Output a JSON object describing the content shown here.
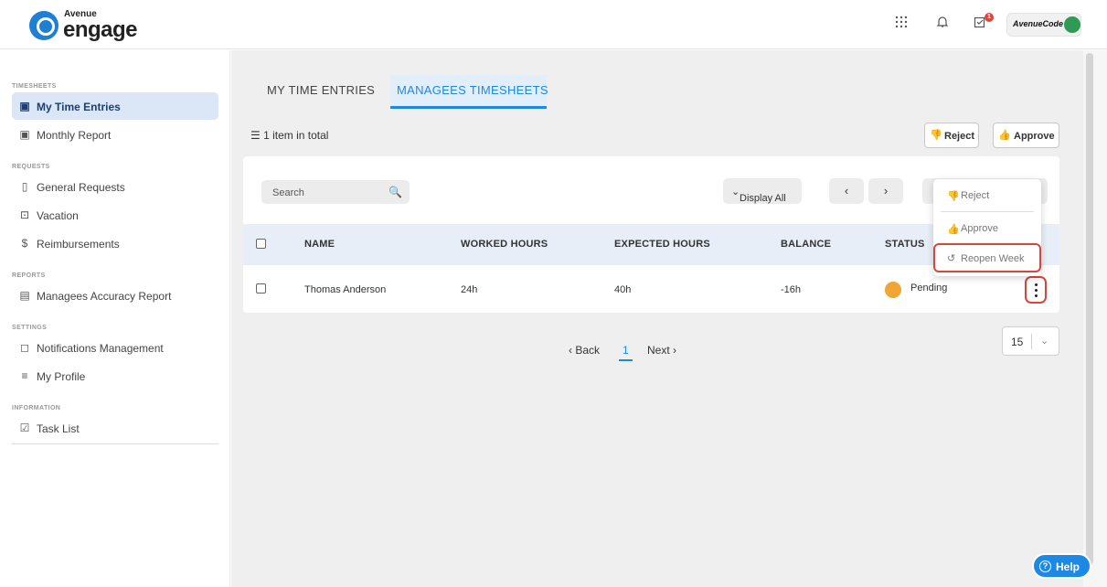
{
  "header": {
    "logo_top": "Avenue",
    "logo_main": "engage",
    "notification_badge": "1",
    "account_logo": "AvenueCode",
    "icons": [
      "apps-grid-icon",
      "bell-icon",
      "tasks-icon",
      "user-avatar-icon"
    ]
  },
  "sidebar": {
    "sections": [
      {
        "title": "TIMESHEETS",
        "items": [
          {
            "label": "My Time Entries",
            "icon": "calendar-icon",
            "active": true
          },
          {
            "label": "Monthly Report",
            "icon": "calendar-icon"
          }
        ]
      },
      {
        "title": "REQUESTS",
        "items": [
          {
            "label": "General Requests",
            "icon": "clipboard-icon"
          },
          {
            "label": "Vacation",
            "icon": "briefcase-icon"
          },
          {
            "label": "Reimbursements",
            "icon": "dollar-icon"
          }
        ]
      },
      {
        "title": "REPORTS",
        "items": [
          {
            "label": "Managees Accuracy Report",
            "icon": "document-icon"
          }
        ]
      },
      {
        "title": "SETTINGS",
        "items": [
          {
            "label": "Notifications Management",
            "icon": "chat-bubble-icon"
          },
          {
            "label": "My Profile",
            "icon": "list-icon"
          }
        ]
      },
      {
        "title": "INFORMATION",
        "items": [
          {
            "label": "Task List",
            "icon": "checkbox-icon"
          }
        ]
      }
    ]
  },
  "main": {
    "tabs": [
      {
        "label": "MY TIME ENTRIES"
      },
      {
        "label": "MANAGEES TIMESHEETS",
        "active": true
      }
    ],
    "total_text": "1 item in total",
    "reject_label": "Reject",
    "approve_label": "Approve",
    "search_placeholder": "Search",
    "display_all": "Display All",
    "table": {
      "columns": [
        "NAME",
        "WORKED HOURS",
        "EXPECTED HOURS",
        "BALANCE",
        "STATUS"
      ],
      "rows": [
        {
          "name": "Thomas Anderson",
          "worked": "24h",
          "expected": "40h",
          "balance": "-16h",
          "status": "Pending",
          "status_color": "#f1a534"
        }
      ]
    },
    "menu": [
      {
        "label": "Reject",
        "icon": "thumbs-down-icon"
      },
      {
        "label": "Approve",
        "icon": "thumbs-up-icon"
      },
      {
        "label": "Reopen Week",
        "icon": "undo-icon"
      }
    ],
    "pagination": {
      "back": "‹ Back",
      "current": "1",
      "next": "Next ›",
      "page_size": "15"
    },
    "help": "Help"
  },
  "colors": {
    "accent": "#1e88e5",
    "active_bg": "#dbe7f6",
    "pending": "#f1a534",
    "highlight": "#d8463b"
  }
}
